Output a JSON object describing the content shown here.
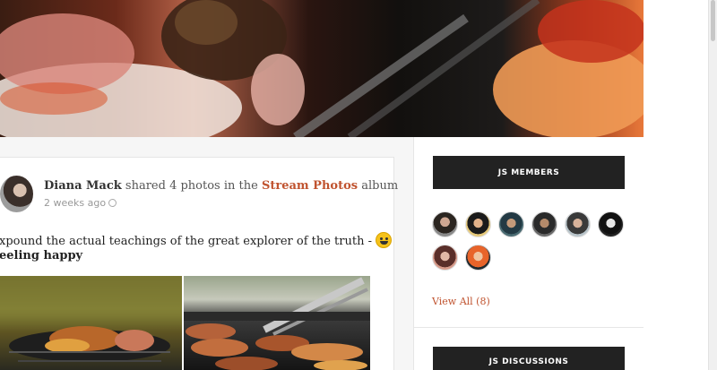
{
  "post": {
    "author": "Diana Mack",
    "action_before": "shared 4 photos in the",
    "album_link": "Stream Photos",
    "action_after": "album",
    "time": "2 weeks ago",
    "text": "xpound the actual teachings of the great explorer of the truth -",
    "feeling": "eeling happy"
  },
  "sidebar": {
    "members_title": "JS MEMBERS",
    "view_all": "View All (8)",
    "discussions_title": "JS DISCUSSIONS"
  },
  "icons": {
    "globe": "globe-icon",
    "emoji": "smiley-icon"
  },
  "colors": {
    "accent": "#c0532f",
    "widget_header": "#222222"
  }
}
